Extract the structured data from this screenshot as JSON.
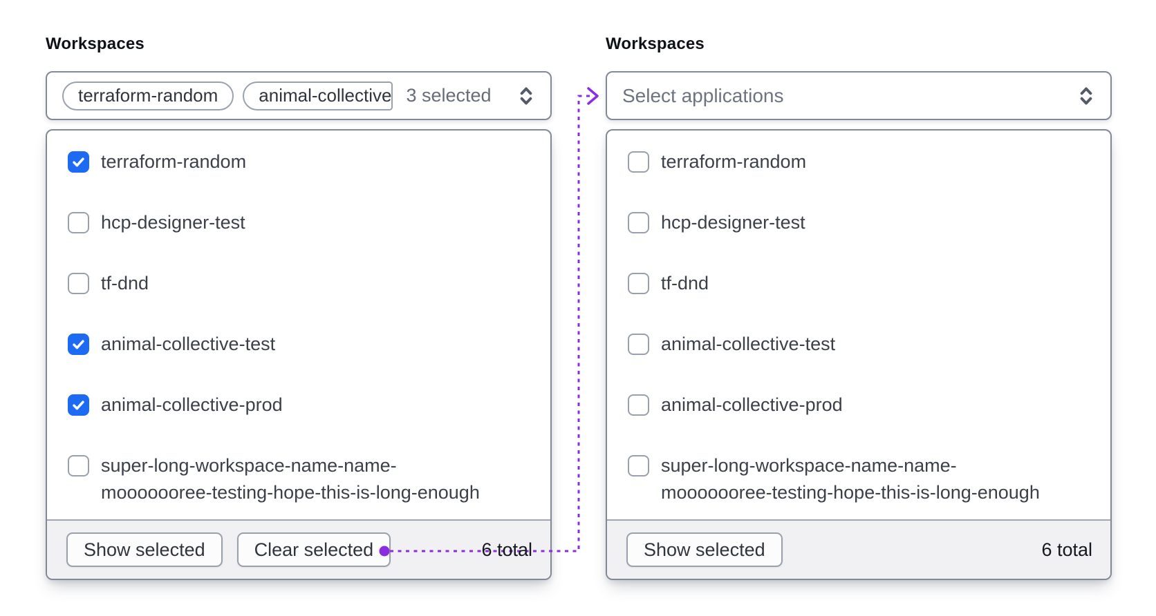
{
  "colors": {
    "checkbox_checked": "#1c6bf2",
    "connector": "#8b2be2"
  },
  "left": {
    "label": "Workspaces",
    "trigger": {
      "tags": [
        "terraform-random",
        "animal-collective"
      ],
      "count_label": "3 selected",
      "chevron_icon": "chevron-up-down-icon"
    },
    "options": [
      {
        "label": "terraform-random",
        "checked": true
      },
      {
        "label": "hcp-designer-test",
        "checked": false
      },
      {
        "label": "tf-dnd",
        "checked": false
      },
      {
        "label": "animal-collective-test",
        "checked": true
      },
      {
        "label": "animal-collective-prod",
        "checked": true
      },
      {
        "label": "super-long-workspace-name-name-",
        "label2": "mooooooree-testing-hope-this-is-long-enough",
        "checked": false
      }
    ],
    "footer": {
      "show_button": "Show selected",
      "clear_button": "Clear selected",
      "total": "6 total"
    }
  },
  "right": {
    "label": "Workspaces",
    "trigger": {
      "placeholder": "Select applications",
      "chevron_icon": "chevron-up-down-icon"
    },
    "options": [
      {
        "label": "terraform-random",
        "checked": false
      },
      {
        "label": "hcp-designer-test",
        "checked": false
      },
      {
        "label": "tf-dnd",
        "checked": false
      },
      {
        "label": "animal-collective-test",
        "checked": false
      },
      {
        "label": "animal-collective-prod",
        "checked": false
      },
      {
        "label": "super-long-workspace-name-name-",
        "label2": "mooooooree-testing-hope-this-is-long-enough",
        "checked": false
      }
    ],
    "footer": {
      "show_button": "Show selected",
      "total": "6 total"
    }
  }
}
